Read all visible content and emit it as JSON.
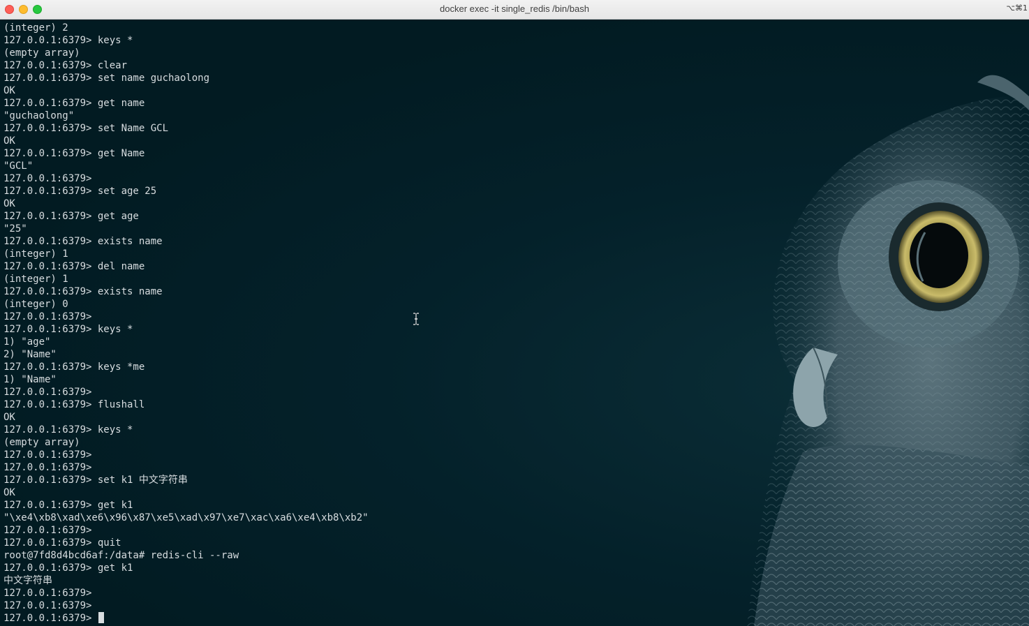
{
  "window": {
    "title": "docker exec -it single_redis /bin/bash",
    "shortcut": "⌥⌘1"
  },
  "terminal": {
    "lines": [
      "(integer) 2",
      "127.0.0.1:6379> keys *",
      "(empty array)",
      "127.0.0.1:6379> clear",
      "127.0.0.1:6379> set name guchaolong",
      "OK",
      "127.0.0.1:6379> get name",
      "\"guchaolong\"",
      "127.0.0.1:6379> set Name GCL",
      "OK",
      "127.0.0.1:6379> get Name",
      "\"GCL\"",
      "127.0.0.1:6379>",
      "127.0.0.1:6379> set age 25",
      "OK",
      "127.0.0.1:6379> get age",
      "\"25\"",
      "127.0.0.1:6379> exists name",
      "(integer) 1",
      "127.0.0.1:6379> del name",
      "(integer) 1",
      "127.0.0.1:6379> exists name",
      "(integer) 0",
      "127.0.0.1:6379>",
      "127.0.0.1:6379> keys *",
      "1) \"age\"",
      "2) \"Name\"",
      "127.0.0.1:6379> keys *me",
      "1) \"Name\"",
      "127.0.0.1:6379>",
      "127.0.0.1:6379> flushall",
      "OK",
      "127.0.0.1:6379> keys *",
      "(empty array)",
      "127.0.0.1:6379>",
      "127.0.0.1:6379>",
      "127.0.0.1:6379> set k1 中文字符串",
      "OK",
      "127.0.0.1:6379> get k1",
      "\"\\xe4\\xb8\\xad\\xe6\\x96\\x87\\xe5\\xad\\x97\\xe7\\xac\\xa6\\xe4\\xb8\\xb2\"",
      "127.0.0.1:6379>",
      "127.0.0.1:6379> quit",
      "root@7fd8d4bcd6af:/data# redis-cli --raw",
      "127.0.0.1:6379> get k1",
      "中文字符串",
      "127.0.0.1:6379>",
      "127.0.0.1:6379>"
    ],
    "prompt": "127.0.0.1:6379> "
  },
  "colors": {
    "background": "#021c23",
    "text": "#d8dde0",
    "owl": "#6e8a94"
  },
  "icons": {
    "background_image": "owl-icon",
    "mouse_cursor": "ibeam-cursor-icon"
  }
}
